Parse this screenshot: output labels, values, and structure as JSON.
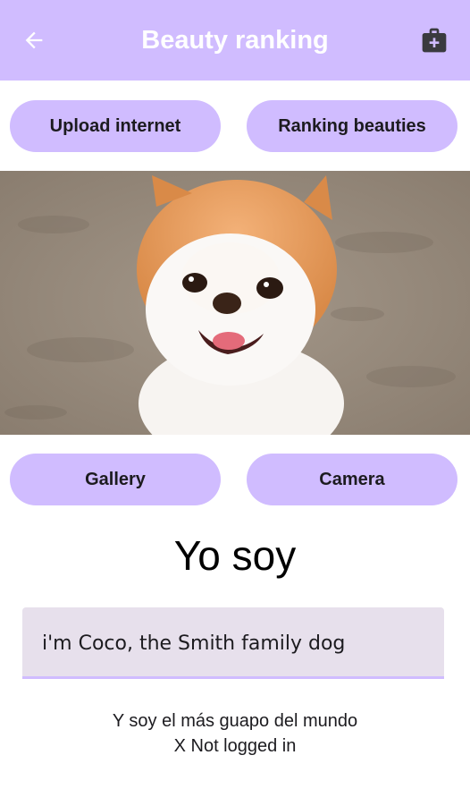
{
  "appbar": {
    "title": "Beauty ranking",
    "back_icon": "arrow-back-icon",
    "action_icon": "medical-case-icon",
    "color": "#d0bcff"
  },
  "buttons": {
    "upload_internet": "Upload internet",
    "ranking_beauties": "Ranking beauties",
    "gallery": "Gallery",
    "camera": "Camera"
  },
  "main": {
    "heading": "Yo soy",
    "input_value": "i'm Coco, the Smith family dog",
    "result_text": "Y soy el más guapo del mundo",
    "login_status": "X Not logged in"
  },
  "colors": {
    "accent": "#d0bcff",
    "field_bg": "#e7e0ec",
    "text": "#1c1b1f"
  }
}
